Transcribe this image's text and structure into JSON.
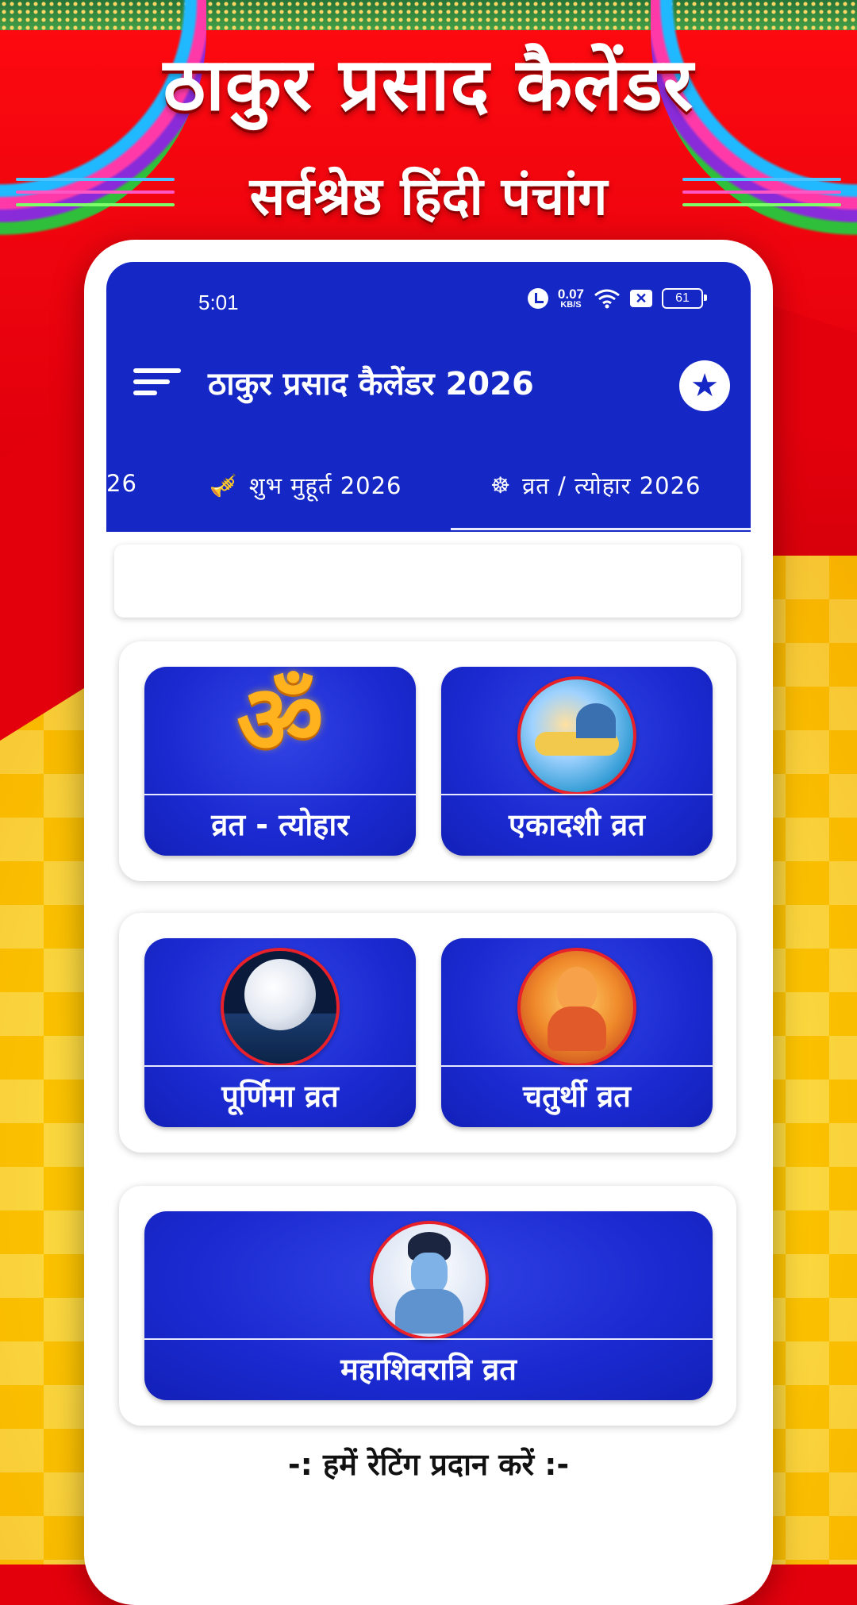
{
  "promo": {
    "title": "ठाकुर प्रसाद कैलेंडर",
    "subtitle": "सर्वश्रेष्ठ हिंदी पंचांग"
  },
  "status_bar": {
    "time": "5:01",
    "net_speed_value": "0.07",
    "net_speed_unit": "KB/S",
    "battery": "61"
  },
  "app_bar": {
    "title": "ठाकुर प्रसाद कैलेंडर 2026",
    "menu_icon": "menu-icon",
    "action_icon": "star-icon"
  },
  "tabs": [
    {
      "label": "26",
      "icon": ""
    },
    {
      "label": "शुभ मुहूर्त 2026",
      "icon": "trumpet-icon"
    },
    {
      "label": "व्रत / त्योहार 2026",
      "icon": "wheel-icon"
    }
  ],
  "tiles": {
    "vrat_tyohar": "व्रत - त्योहार",
    "ekadashi": "एकादशी व्रत",
    "purnima": "पूर्णिमा व्रत",
    "chaturthi": "चतुर्थी व्रत",
    "mahashivratri": "महाशिवरात्रि व्रत"
  },
  "om_symbol": "ॐ",
  "rating_prompt": "-: हमें रेटिंग प्रदान करें :-",
  "colors": {
    "primary": "#1527c4",
    "tile": "#1a2ad0",
    "promo_red": "#e3000c",
    "promo_yellow": "#ffd000",
    "medallion_border": "#e8202a"
  }
}
